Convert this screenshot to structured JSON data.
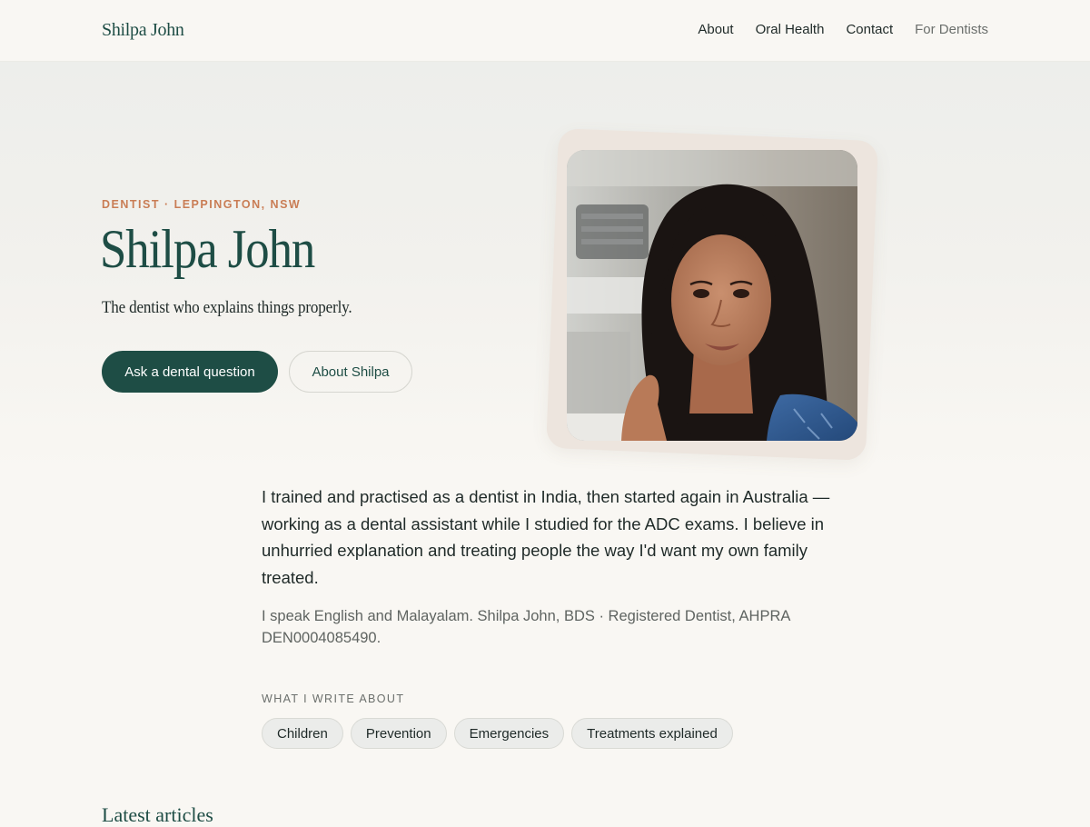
{
  "header": {
    "brand": "Shilpa John",
    "nav": [
      {
        "label": "About"
      },
      {
        "label": "Oral Health"
      },
      {
        "label": "Contact"
      },
      {
        "label": "For Dentists"
      }
    ]
  },
  "hero": {
    "eyebrow": "DENTIST · LEPPINGTON, NSW",
    "title": "Shilpa John",
    "tagline": "The dentist who explains things properly.",
    "primary_button": "Ask a dental question",
    "secondary_button": "About Shilpa"
  },
  "intro": {
    "paragraph": "I trained and practised as a dentist in India, then started again in Australia — working as a dental assistant while I studied for the ADC exams. I believe in unhurried explanation and treating people the way I'd want my own family treated.",
    "credentials": "I speak English and Malayalam. Shilpa John, BDS · Registered Dentist, AHPRA DEN0004085490."
  },
  "topics": {
    "label": "WHAT I WRITE ABOUT",
    "items": [
      {
        "label": "Children"
      },
      {
        "label": "Prevention"
      },
      {
        "label": "Emergencies"
      },
      {
        "label": "Treatments explained"
      }
    ]
  },
  "latest": {
    "heading": "Latest articles"
  },
  "colors": {
    "brand_green": "#1e4d45",
    "accent_terracotta": "#c97d55",
    "background": "#f9f7f3"
  }
}
